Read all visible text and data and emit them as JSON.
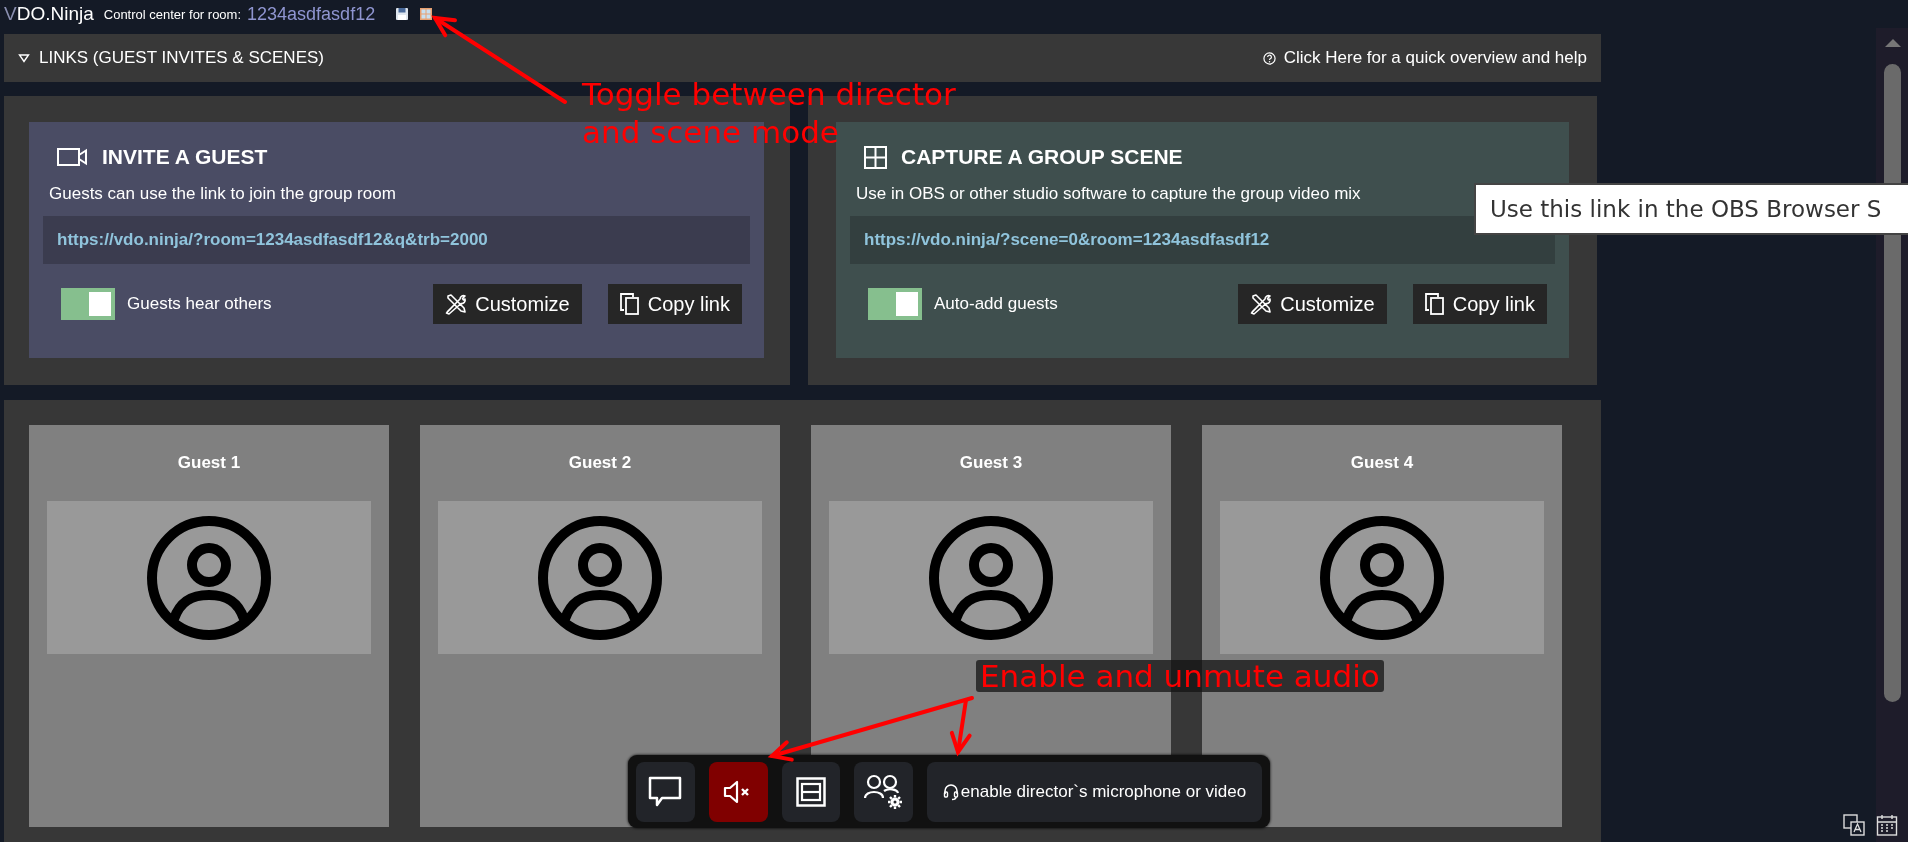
{
  "header": {
    "logo": {
      "accent": "V",
      "text": "DO.Ninja"
    },
    "room_label": "Control center for room:",
    "room_id": "1234asdfasdf12"
  },
  "links_bar": {
    "title": "LINKS (GUEST INVITES & SCENES)",
    "expanded": true,
    "help": "Click Here for a quick overview and help"
  },
  "cards": [
    {
      "kind": "invite",
      "title": "INVITE A GUEST",
      "description": "Guests can use the link to join the group room",
      "url": "https://vdo.ninja/?room=1234asdfasdf12&q&trb=2000",
      "toggle": {
        "label": "Guests hear others",
        "on": true
      },
      "buttons": [
        "Customize",
        "Copy link"
      ]
    },
    {
      "kind": "scene",
      "title": "CAPTURE A GROUP SCENE",
      "description": "Use in OBS or other studio software to capture the group video mix",
      "url": "https://vdo.ninja/?scene=0&room=1234asdfasdf12",
      "toggle": {
        "label": "Auto-add guests",
        "on": true
      },
      "buttons": [
        "Customize",
        "Copy link"
      ]
    }
  ],
  "guests": [
    {
      "title": "Guest 1"
    },
    {
      "title": "Guest 2"
    },
    {
      "title": "Guest 3"
    },
    {
      "title": "Guest 4"
    }
  ],
  "toolbar": [
    {
      "kind": "chat"
    },
    {
      "kind": "mute",
      "muted": true
    },
    {
      "kind": "layout"
    },
    {
      "kind": "settings"
    },
    {
      "kind": "mic",
      "label": "enable director`s microphone or video"
    }
  ],
  "tooltip": {
    "text": "Use this link in the OBS Browser S"
  },
  "annotations": [
    {
      "lines": [
        "Toggle between director",
        "and scene mode"
      ]
    },
    {
      "lines": [
        "Enable and unmute audio"
      ]
    }
  ]
}
